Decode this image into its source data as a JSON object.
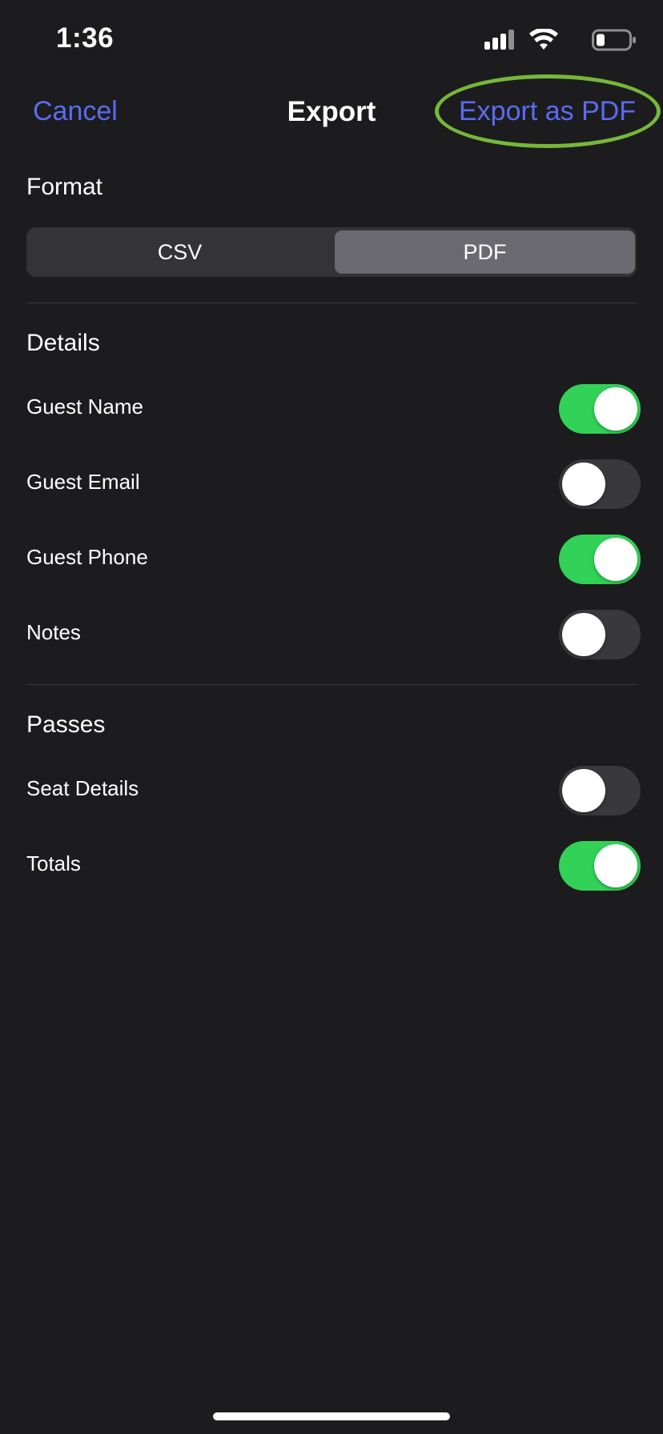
{
  "status": {
    "time": "1:36"
  },
  "nav": {
    "cancel": "Cancel",
    "title": "Export",
    "action": "Export as PDF"
  },
  "format": {
    "title": "Format",
    "options": [
      "CSV",
      "PDF"
    ],
    "selected": "PDF"
  },
  "details": {
    "title": "Details",
    "items": [
      {
        "label": "Guest Name",
        "on": true
      },
      {
        "label": "Guest Email",
        "on": false
      },
      {
        "label": "Guest Phone",
        "on": true
      },
      {
        "label": "Notes",
        "on": false
      }
    ]
  },
  "passes": {
    "title": "Passes",
    "items": [
      {
        "label": "Seat Details",
        "on": false
      },
      {
        "label": "Totals",
        "on": true
      }
    ]
  },
  "colors": {
    "background": "#1c1c1e",
    "link": "#5c6bf0",
    "toggle_on": "#32d158",
    "toggle_off": "#39393d",
    "highlight_ring": "#76b83a"
  }
}
